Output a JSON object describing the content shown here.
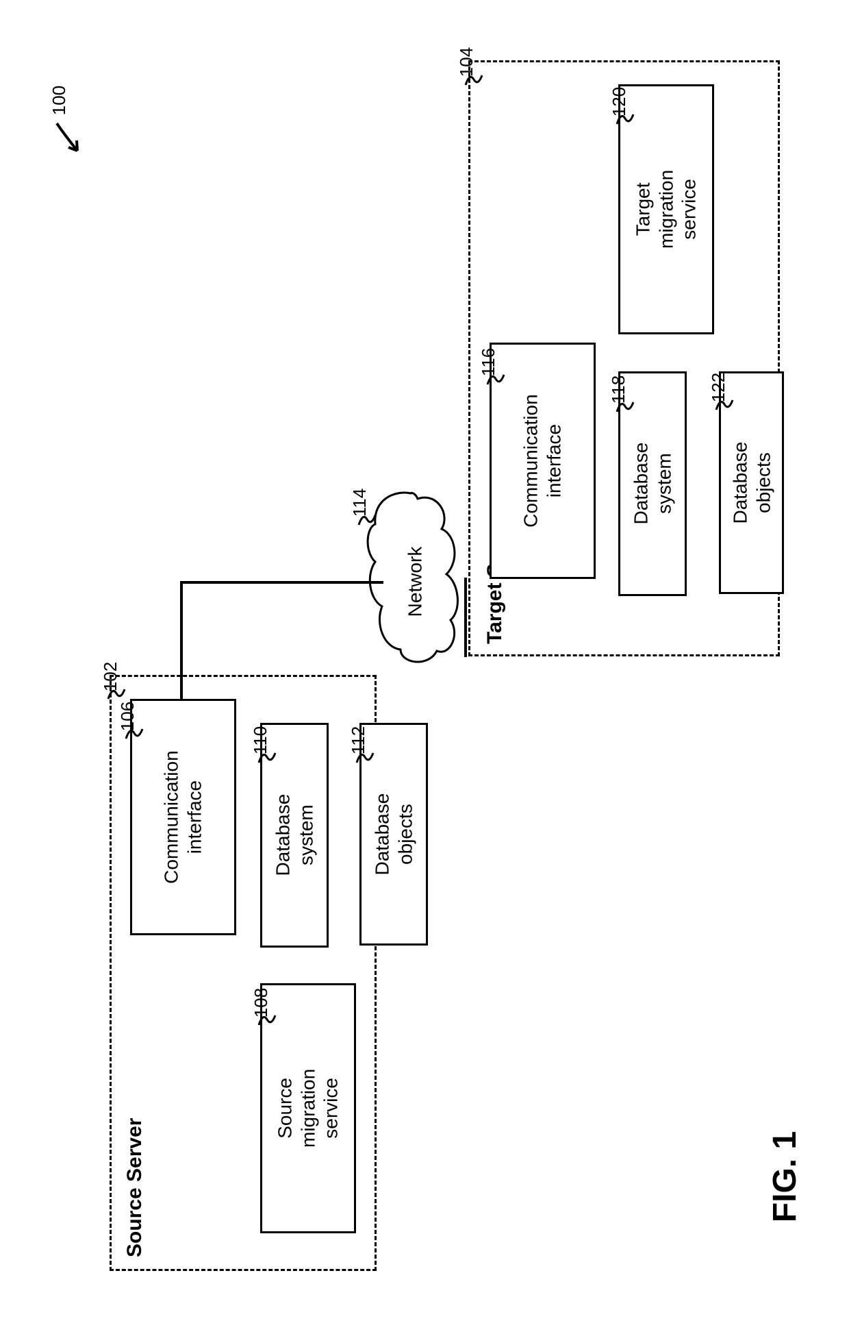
{
  "figure": {
    "caption": "FIG. 1",
    "overall_ref": "100"
  },
  "network": {
    "label": "Network",
    "ref": "114"
  },
  "source_server": {
    "title": "Source Server",
    "ref": "102",
    "components": {
      "comm_interface": {
        "label": "Communication\ninterface",
        "ref": "106"
      },
      "migration_service": {
        "label": "Source migration\nservice",
        "ref": "108"
      },
      "database_system": {
        "label": "Database system",
        "ref": "110"
      },
      "database_objects": {
        "label": "Database objects",
        "ref": "112"
      }
    }
  },
  "target_server": {
    "title": "Target Server",
    "ref": "104",
    "components": {
      "comm_interface": {
        "label": "Communication\ninterface",
        "ref": "116"
      },
      "migration_service": {
        "label": "Target migration\nservice",
        "ref": "120"
      },
      "database_system": {
        "label": "Database system",
        "ref": "118"
      },
      "database_objects": {
        "label": "Database objects",
        "ref": "122"
      }
    }
  }
}
